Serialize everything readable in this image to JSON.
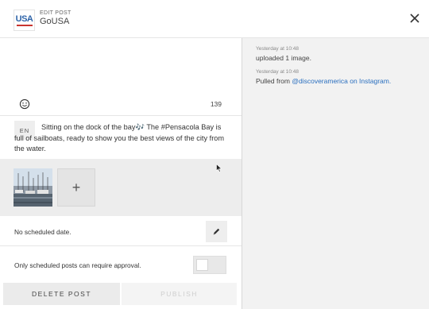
{
  "header": {
    "subtitle": "EDIT POST",
    "title": "GoUSA",
    "logo_text": "USA",
    "close_icon": "close-icon"
  },
  "editor": {
    "char_count": "139",
    "emoji_icon": "smiley-icon",
    "language": "EN",
    "post_text": "Sitting on the dock of the bay🎶 The #Pensacola Bay is full of sailboats, ready to show you the best views of the city from the water."
  },
  "media": {
    "add_label": "+",
    "thumbnail_icon": "harbor-photo"
  },
  "schedule": {
    "text": "No scheduled date.",
    "edit_icon": "pencil-icon"
  },
  "approval": {
    "text": "Only scheduled posts can require approval.",
    "toggle_on": false
  },
  "footer": {
    "delete_label": "DELETE POST",
    "publish_label": "PUBLISH"
  },
  "activity": [
    {
      "time": "Yesterday at 10:48",
      "text": "uploaded 1 image."
    },
    {
      "time": "Yesterday at 10:48",
      "text": "Pulled from ",
      "link": "@discoveramerica on Instagram."
    }
  ],
  "colors": {
    "link": "#2a6fbf",
    "panel_bg": "#f2f2f2",
    "media_bg": "#ededed"
  }
}
